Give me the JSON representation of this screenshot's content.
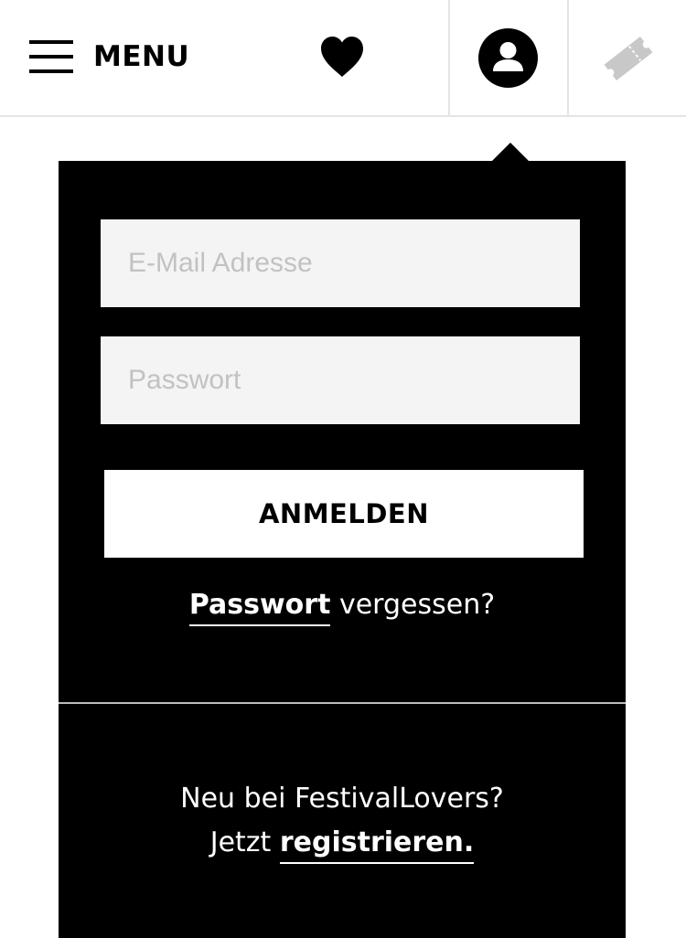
{
  "header": {
    "menu_label": "MENU",
    "heart_icon": "heart-icon",
    "user_icon": "user-icon",
    "ticket_icon": "ticket-icon"
  },
  "login": {
    "email_placeholder": "E-Mail Adresse",
    "email_value": "",
    "password_placeholder": "Passwort",
    "password_value": "",
    "submit_label": "ANMELDEN",
    "forgot_link": "Passwort",
    "forgot_suffix": " vergessen?"
  },
  "signup": {
    "line1": "Neu bei FestivalLovers?",
    "prefix": "Jetzt ",
    "link": "registrieren."
  },
  "colors": {
    "panel_bg": "#000000",
    "input_bg": "#f4f4f4",
    "placeholder": "#c2c2c2",
    "ticket_icon": "#c8c8c8",
    "divider": "#e4e4e4"
  }
}
